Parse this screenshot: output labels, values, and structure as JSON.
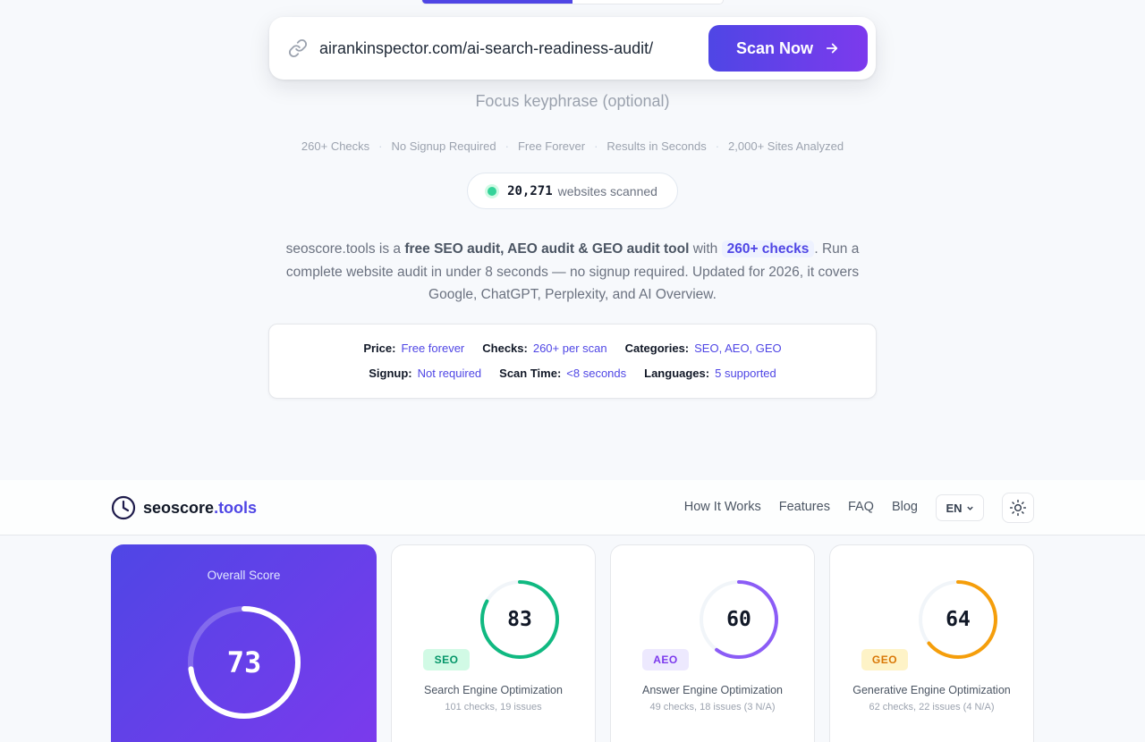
{
  "scan": {
    "url": "airankinspector.com/ai-search-readiness-audit/",
    "button_label": "Scan Now",
    "keyphrase_placeholder": "Focus keyphrase (optional)"
  },
  "features": [
    "260+ Checks",
    "No Signup Required",
    "Free Forever",
    "Results in Seconds",
    "2,000+ Sites Analyzed"
  ],
  "counter": {
    "number": "20,271",
    "label": "websites scanned"
  },
  "intro": {
    "part1": "seoscore.tools is a ",
    "bold": "free SEO audit, AEO audit & GEO audit tool",
    "part2": " with ",
    "pill": "260+ checks",
    "part3": ". Run a complete website audit in under 8 seconds — no signup required. Updated for 2026, it covers Google, ChatGPT, Perplexity, and AI Overview."
  },
  "facts": {
    "row1": [
      {
        "key": "Price:",
        "value": "Free forever"
      },
      {
        "key": "Checks:",
        "value": "260+ per scan"
      },
      {
        "key": "Categories:",
        "value": "SEO, AEO, GEO"
      }
    ],
    "row2": [
      {
        "key": "Signup:",
        "value": "Not required"
      },
      {
        "key": "Scan Time:",
        "value": "<8 seconds"
      },
      {
        "key": "Languages:",
        "value": "5 supported"
      }
    ]
  },
  "nav": {
    "brand_main": "seoscore",
    "brand_accent": ".tools",
    "links": [
      "How It Works",
      "Features",
      "FAQ",
      "Blog"
    ],
    "lang": "EN"
  },
  "overall": {
    "label": "Overall Score",
    "score": "73",
    "fraction": 0.73
  },
  "cards": [
    {
      "score": "83",
      "fraction": 0.83,
      "badge": "SEO",
      "title": "Search Engine Optimization",
      "sub": "101 checks, 19 issues",
      "color": "#10b981",
      "badge_bg": "#d1fae5",
      "badge_fg": "#059669"
    },
    {
      "score": "60",
      "fraction": 0.6,
      "badge": "AEO",
      "title": "Answer Engine Optimization",
      "sub": "49 checks, 18 issues (3 N/A)",
      "color": "#8b5cf6",
      "badge_bg": "#ede9fe",
      "badge_fg": "#7c3aed"
    },
    {
      "score": "64",
      "fraction": 0.64,
      "badge": "GEO",
      "title": "Generative Engine Optimization",
      "sub": "62 checks, 22 issues (4 N/A)",
      "color": "#f59e0b",
      "badge_bg": "#fef3c7",
      "badge_fg": "#d97706"
    }
  ]
}
